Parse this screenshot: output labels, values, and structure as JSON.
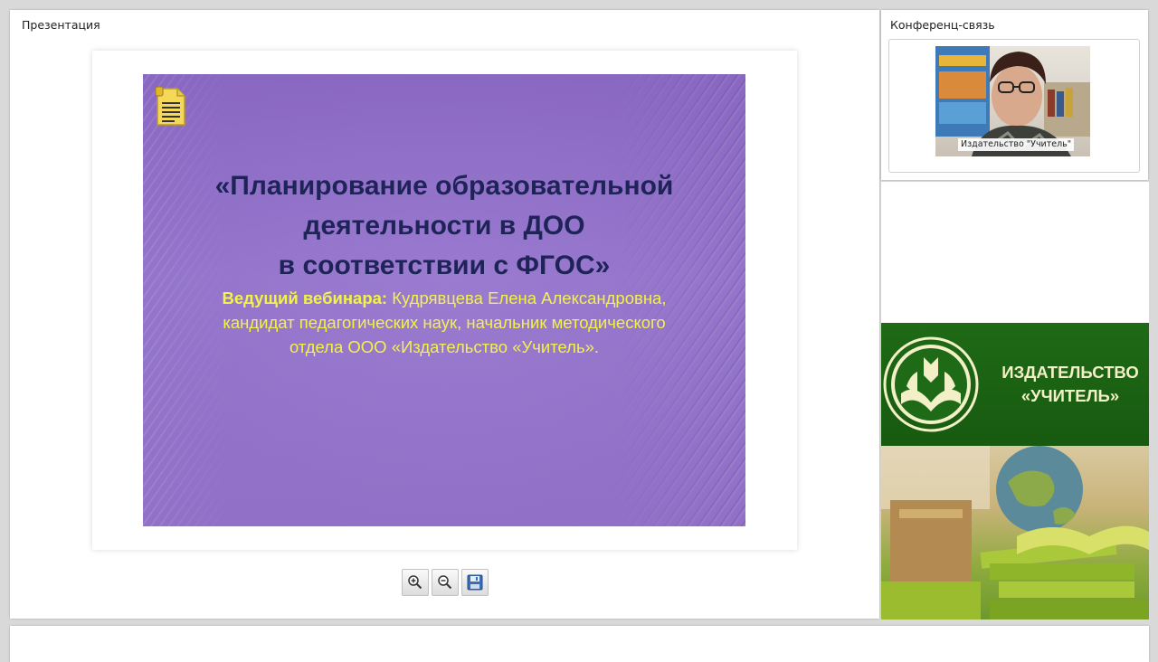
{
  "presentation": {
    "panel_title": "Презентация",
    "slide": {
      "heading_lines": [
        "«Планирование образовательной",
        "деятельности в ДОО",
        "в соответствии с ФГОС»"
      ],
      "presenter_label": "Ведущий вебинара:",
      "presenter_name": " Кудрявцева Елена Александровна,",
      "presenter_line2": "кандидат педагогических наук, начальник методического",
      "presenter_line3": "отдела ООО «Издательство «Учитель».",
      "icon": "document-icon",
      "colors": {
        "background": "#9a7bd0",
        "heading": "#1f2458",
        "subtitle": "#f2f24a"
      }
    },
    "toolbar": {
      "zoom_in_icon": "zoom-in-icon",
      "zoom_out_icon": "zoom-out-icon",
      "save_icon": "save-icon"
    }
  },
  "conference": {
    "panel_title": "Конференц-связь",
    "video_caption": "Издательство \"Учитель\""
  },
  "banner": {
    "title_line1": "ИЗДАТЕЛЬСТВО",
    "title_line2": "«УЧИТЕЛЬ»",
    "colors": {
      "green": "#1f6a16",
      "text": "#f3f0c8"
    }
  }
}
